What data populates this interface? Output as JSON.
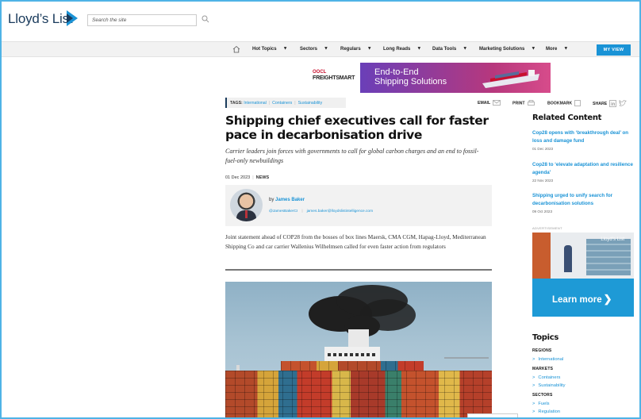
{
  "header": {
    "logo_text": "Lloyd’s List",
    "search_placeholder": "Search the site"
  },
  "nav": {
    "items": [
      {
        "label": "Hot Topics"
      },
      {
        "label": "Sectors"
      },
      {
        "label": "Regulars"
      },
      {
        "label": "Long Reads"
      },
      {
        "label": "Data Tools"
      },
      {
        "label": "Marketing Solutions"
      },
      {
        "label": "More"
      }
    ],
    "my_view": "MY VIEW"
  },
  "ad_banner": {
    "brand_top": "OOCL",
    "brand_main": "FREIGHTSMART",
    "headline_line1": "End-to-End",
    "headline_line2": "Shipping Solutions"
  },
  "tags": {
    "label": "TAGS:",
    "items": [
      "International",
      "Containers",
      "Sustainability"
    ]
  },
  "tools": {
    "email": "EMAIL",
    "print": "PRINT",
    "bookmark": "BOOKMARK",
    "share": "SHARE"
  },
  "article": {
    "headline": "Shipping chief executives call for faster pace in decarbonisation drive",
    "standfirst": "Carrier leaders join forces with governments to call for global carbon charges and an end to fossil-fuel-only newbuildings",
    "date": "01 Dec 2023",
    "section": "NEWS",
    "author_prefix": "by",
    "author_name": "James Baker",
    "author_twitter": "@JamesBakerCI",
    "author_email": "james.baker@lloydslistintelligence.com",
    "summary": "Joint statement ahead of COP28 from the bosses of box lines Maersk, CMA CGM, Hapag-Lloyd, Mediterranean Shipping Co and car carrier Wallenius Wilhelmsen called for even faster action from regulators"
  },
  "sidebar": {
    "related_title": "Related Content",
    "related": [
      {
        "title": "Cop28 opens with ‘breakthrough deal’ on loss and damage fund",
        "date": "01 Dec 2023"
      },
      {
        "title": "Cop28 to ‘elevate adaptation and resilience agenda’",
        "date": "22 Nov 2023"
      },
      {
        "title": "Shipping urged to unify search for decarbonisation solutions",
        "date": "09 Oct 2023"
      }
    ],
    "advert_label": "ADVERTISEMENT",
    "advert_logo": "Lloyd’s List",
    "advert_cta": "Learn more",
    "topics_title": "Topics",
    "topic_groups": [
      {
        "heading": "REGIONS",
        "links": [
          "International"
        ]
      },
      {
        "heading": "MARKETS",
        "links": [
          "Containers",
          "Sustainability"
        ]
      },
      {
        "heading": "SECTORS",
        "links": [
          "Fuels",
          "Regulation"
        ]
      }
    ]
  },
  "colors": {
    "accent": "#1a93d6",
    "brand_navy": "#1a3b5c",
    "frame": "#4fb3e6"
  }
}
